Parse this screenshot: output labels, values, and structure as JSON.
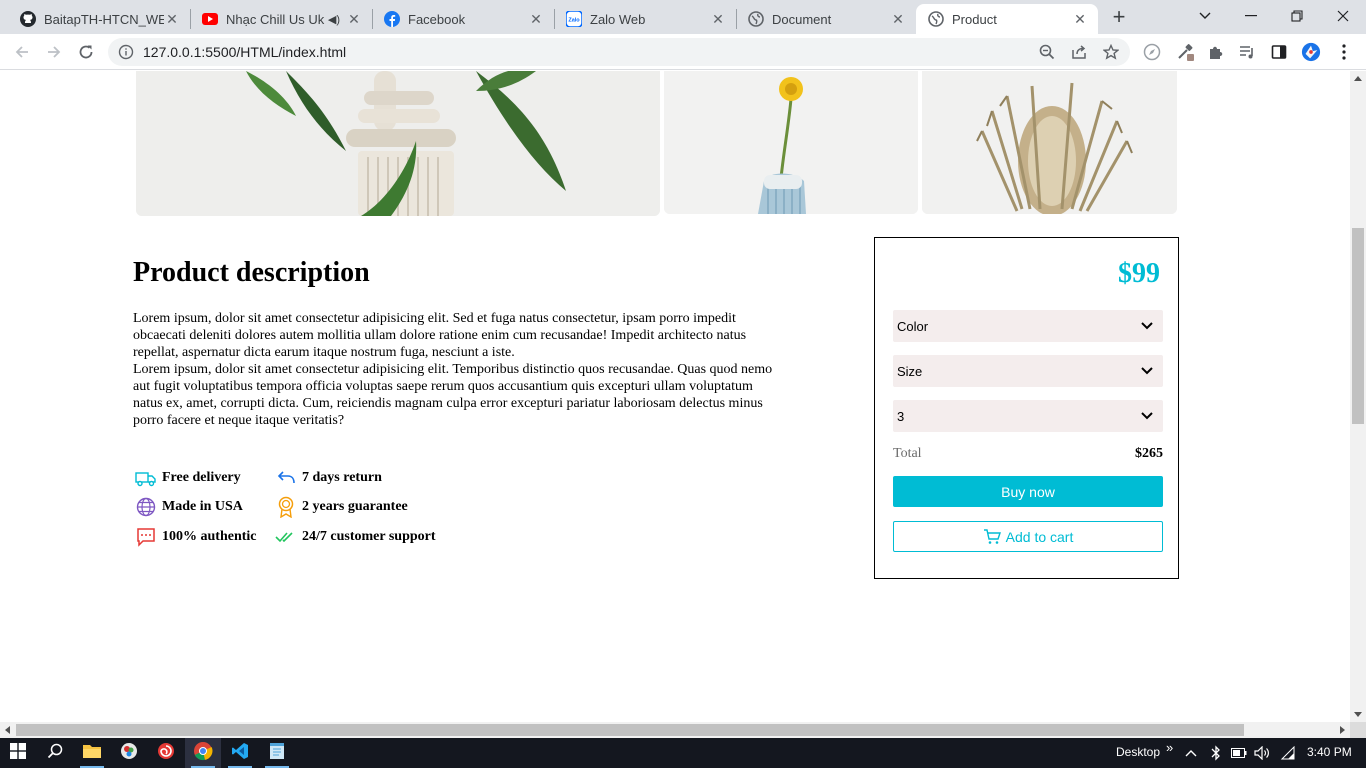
{
  "browser": {
    "tabs": [
      {
        "title": "BaitapTH-HTCN_WEB/",
        "icon": "github-icon"
      },
      {
        "title": "Nhạc Chill Us Uk -",
        "icon": "youtube-icon"
      },
      {
        "title": "Facebook",
        "icon": "facebook-icon"
      },
      {
        "title": "Zalo Web",
        "icon": "zalo-icon"
      },
      {
        "title": "Document",
        "icon": "globe-icon"
      },
      {
        "title": "Product",
        "icon": "globe-icon",
        "active": true
      }
    ],
    "url": "127.0.0.1:5500/HTML/index.html",
    "zalo_badge": "Zalo"
  },
  "product": {
    "description_title": "Product description",
    "description_paragraphs": [
      "Lorem ipsum, dolor sit amet consectetur adipisicing elit. Sed et fuga natus consectetur, ipsam porro impedit obcaecati deleniti dolores autem mollitia ullam dolore ratione enim cum recusandae! Impedit architecto natus repellat, aspernatur dicta earum itaque nostrum fuga, nesciunt a iste.",
      "Lorem ipsum, dolor sit amet consectetur adipisicing elit. Temporibus distinctio quos recusandae. Quas quod nemo aut fugit voluptatibus tempora officia voluptas saepe rerum quos accusantium quis excepturi ullam voluptatum natus ex, amet, corrupti dicta. Cum, reiciendis magnam culpa error excepturi pariatur laboriosam delectus minus porro facere et neque itaque veritatis?"
    ],
    "features": [
      {
        "label": "Free delivery",
        "icon": "truck-icon"
      },
      {
        "label": "7 days return",
        "icon": "return-arrow-icon"
      },
      {
        "label": "Made in USA",
        "icon": "globe-icon"
      },
      {
        "label": "2 years guarantee",
        "icon": "award-icon"
      },
      {
        "label": "100% authentic",
        "icon": "chat-icon"
      },
      {
        "label": "24/7 customer support",
        "icon": "double-check-icon"
      }
    ]
  },
  "buybox": {
    "price": "$99",
    "color_select": "Color",
    "size_select": "Size",
    "quantity_select": "3",
    "total_label": "Total",
    "total_value": "$265",
    "buy_now_label": "Buy now",
    "add_to_cart_label": "Add to cart",
    "accent_color": "#00bcd4"
  },
  "taskbar": {
    "desktop_label": "Desktop",
    "chevrons": "»",
    "time": "3:40 PM"
  }
}
